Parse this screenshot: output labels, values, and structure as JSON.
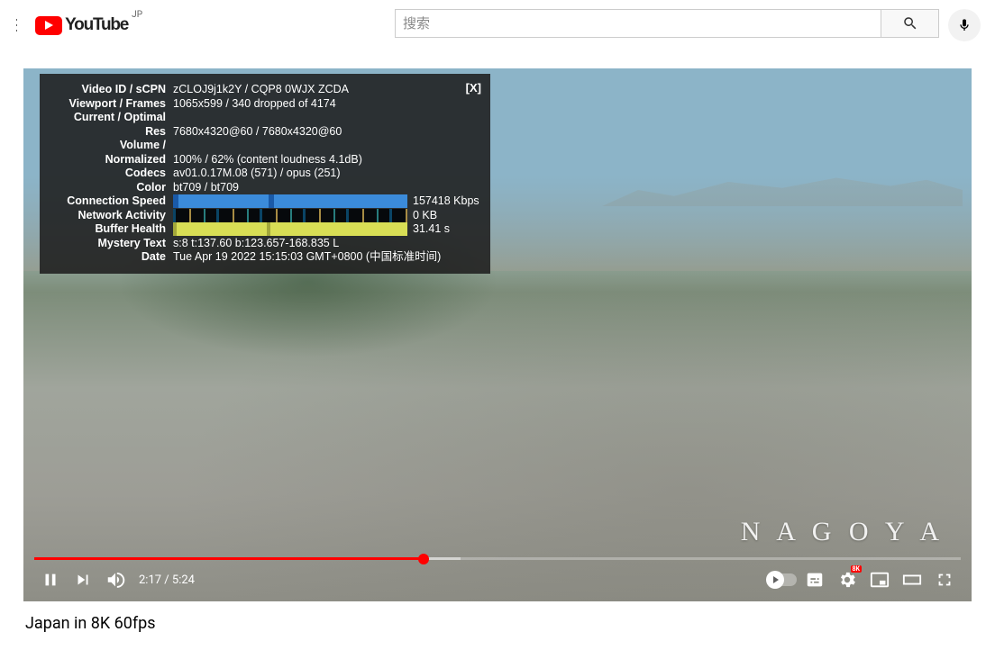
{
  "header": {
    "logo_text": "YouTube",
    "region": "JP",
    "search_placeholder": "搜索"
  },
  "video": {
    "title": "Japan in 8K 60fps",
    "watermark": "N A G O Y A",
    "current_time": "2:17",
    "duration": "5:24",
    "progress_played_pct": 42,
    "progress_buffer_pct": 46,
    "settings_badge": "8K"
  },
  "nerd_stats": {
    "close_label": "[X]",
    "rows": [
      {
        "label": "Video ID / sCPN",
        "value": "zCLOJ9j1k2Y / CQP8 0WJX ZCDA"
      },
      {
        "label": "Viewport / Frames",
        "value": "1065x599 / 340 dropped of 4174"
      },
      {
        "label": "Current / Optimal Res",
        "value": "7680x4320@60 / 7680x4320@60",
        "two_line_label": true
      },
      {
        "label": "Volume / Normalized",
        "value": "100% / 62% (content loudness 4.1dB)",
        "two_line_label": true
      },
      {
        "label": "Codecs",
        "value": "av01.0.17M.08 (571) / opus (251)"
      },
      {
        "label": "Color",
        "value": "bt709 / bt709"
      }
    ],
    "bars": [
      {
        "label": "Connection Speed",
        "value": "157418 Kbps",
        "kind": "blue"
      },
      {
        "label": "Network Activity",
        "value": "0 KB",
        "kind": "net"
      },
      {
        "label": "Buffer Health",
        "value": "31.41 s",
        "kind": "green"
      }
    ],
    "tail": [
      {
        "label": "Mystery Text",
        "value": "s:8 t:137.60 b:123.657-168.835 L"
      },
      {
        "label": "Date",
        "value": "Tue Apr 19 2022 15:15:03 GMT+0800 (中国标准时间)"
      }
    ]
  }
}
